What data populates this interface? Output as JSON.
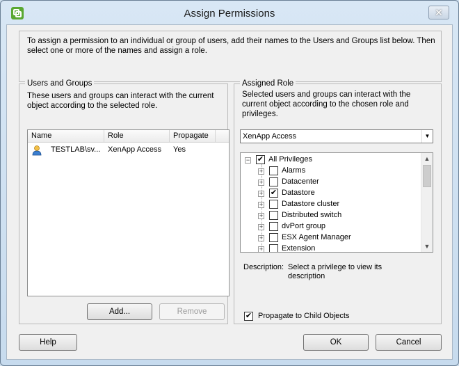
{
  "window": {
    "title": "Assign Permissions",
    "close_label": "✕"
  },
  "intro": {
    "text": "To assign a permission to an individual or group of users, add their names to the Users and Groups list below. Then select one or more of the names and assign a role."
  },
  "users_groups": {
    "legend": "Users and Groups",
    "description": "These users and groups can interact with the current object according to the selected role.",
    "columns": [
      "Name",
      "Role",
      "Propagate"
    ],
    "rows": [
      {
        "name": "TESTLAB\\sv...",
        "role": "XenApp Access",
        "propagate": "Yes"
      }
    ],
    "add_label": "Add...",
    "remove_label": "Remove"
  },
  "assigned_role": {
    "legend": "Assigned Role",
    "description": "Selected users and groups can interact with the current object according to the chosen role and privileges.",
    "selected_role": "XenApp Access",
    "privileges_root": {
      "label": "All Privileges",
      "checked": true
    },
    "privileges": [
      {
        "label": "Alarms",
        "checked": false
      },
      {
        "label": "Datacenter",
        "checked": false
      },
      {
        "label": "Datastore",
        "checked": true
      },
      {
        "label": "Datastore cluster",
        "checked": false
      },
      {
        "label": "Distributed switch",
        "checked": false
      },
      {
        "label": "dvPort group",
        "checked": false
      },
      {
        "label": "ESX Agent Manager",
        "checked": false
      },
      {
        "label": "Extension",
        "checked": false
      }
    ],
    "description_label": "Description:",
    "description_value": "Select a privilege to view its description",
    "propagate_label": "Propagate to Child Objects",
    "propagate_checked": true
  },
  "footer": {
    "help_label": "Help",
    "ok_label": "OK",
    "cancel_label": "Cancel"
  },
  "colors": {
    "window_frame": "#c7dbee",
    "client_bg": "#f0f0f0"
  },
  "icons": {
    "app": "vsphere-logo-icon",
    "user": "user-icon"
  }
}
